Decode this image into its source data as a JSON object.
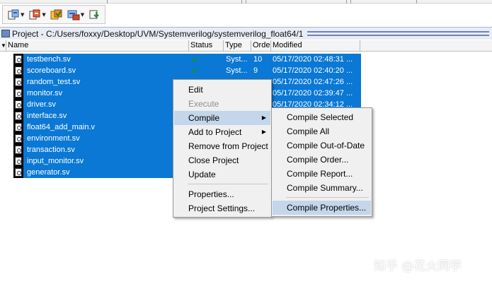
{
  "toolbar": {
    "buttons": [
      {
        "icon": "add-file-icon"
      },
      {
        "icon": "remove-file-icon"
      },
      {
        "icon": "compile-icon"
      },
      {
        "icon": "simulate-icon"
      },
      {
        "icon": "download-icon"
      }
    ]
  },
  "project": {
    "title": "Project - C:/Users/foxxy/Desktop/UVM/Systemverilog/systemverilog_float64/1"
  },
  "table": {
    "columns": [
      "Name",
      "Status",
      "Type",
      "Order",
      "Modified"
    ],
    "rows": [
      {
        "name": "testbench.sv",
        "status": "✓",
        "type": "Syst...",
        "order": "10",
        "modified": "05/17/2020 02:48:31 ..."
      },
      {
        "name": "scoreboard.sv",
        "status": "✓",
        "type": "Syst...",
        "order": "9",
        "modified": "05/17/2020 02:40:20 ..."
      },
      {
        "name": "random_test.sv",
        "status": "",
        "type": "",
        "order": "",
        "modified": "05/17/2020 02:47:26 ..."
      },
      {
        "name": "monitor.sv",
        "status": "",
        "type": "",
        "order": "",
        "modified": "05/17/2020 02:39:47 ..."
      },
      {
        "name": "driver.sv",
        "status": "",
        "type": "",
        "order": "",
        "modified": "05/17/2020 02:34:12 ..."
      },
      {
        "name": "interface.sv",
        "status": "",
        "type": "",
        "order": "",
        "modified": ""
      },
      {
        "name": "float64_add_main.v",
        "status": "",
        "type": "",
        "order": "",
        "modified": ""
      },
      {
        "name": "environment.sv",
        "status": "",
        "type": "",
        "order": "",
        "modified": ""
      },
      {
        "name": "transaction.sv",
        "status": "",
        "type": "",
        "order": "",
        "modified": ""
      },
      {
        "name": "input_monitor.sv",
        "status": "",
        "type": "",
        "order": "",
        "modified": ""
      },
      {
        "name": "generator.sv",
        "status": "",
        "type": "",
        "order": "",
        "modified": ""
      }
    ]
  },
  "context_menu": {
    "items": [
      "Edit",
      "Execute",
      "Compile",
      "Add to Project",
      "Remove from Project",
      "Close Project",
      "Update",
      "Properties...",
      "Project Settings..."
    ],
    "disabled": [
      "Execute"
    ],
    "highlighted": "Compile"
  },
  "compile_submenu": {
    "items": [
      "Compile Selected",
      "Compile All",
      "Compile Out-of-Date",
      "Compile Order...",
      "Compile Report...",
      "Compile Summary...",
      "Compile Properties..."
    ],
    "highlighted": "Compile Properties..."
  },
  "watermark": "知乎 @花火同学",
  "colors": {
    "selection": "#0a78d4",
    "menu_highlight": "#c3d6ea",
    "status_check": "#1b8f23"
  }
}
